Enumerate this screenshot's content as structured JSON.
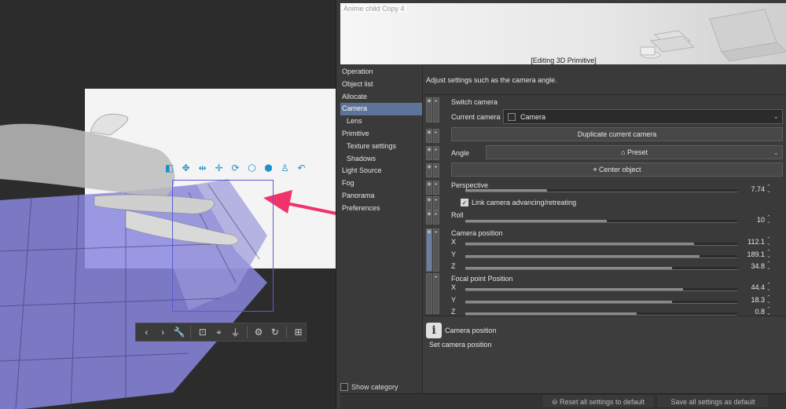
{
  "canvas": {
    "object_toolbar_icons": [
      "move-camera-icon",
      "pan-icon",
      "rotate-icon",
      "move-object-icon",
      "rotate-object-icon",
      "rotate-xy-icon",
      "scale-icon",
      "pose-icon",
      "undo-icon"
    ],
    "bottom_toolbar_icons": [
      "previous-icon",
      "next-icon",
      "wrench-icon",
      "camera-icon",
      "fit-icon",
      "ground-icon",
      "object-settings-icon",
      "rotate-reset-icon",
      "transform-icon"
    ],
    "accent_color": "#5b5bd0",
    "arrow_color": "#f0336b"
  },
  "panel": {
    "preview_title": "Anime child Copy 4",
    "preview_status": "[Editing 3D Primitive]",
    "categories": [
      {
        "label": "Operation",
        "sub": false,
        "active": false
      },
      {
        "label": "Object list",
        "sub": false,
        "active": false
      },
      {
        "label": "Allocate",
        "sub": false,
        "active": false
      },
      {
        "label": "Camera",
        "sub": false,
        "active": true
      },
      {
        "label": "Lens",
        "sub": true,
        "active": false
      },
      {
        "label": "Primitive",
        "sub": false,
        "active": false
      },
      {
        "label": "Texture settings",
        "sub": true,
        "active": false
      },
      {
        "label": "Shadows",
        "sub": true,
        "active": false
      },
      {
        "label": "Light Source",
        "sub": false,
        "active": false
      },
      {
        "label": "Fog",
        "sub": false,
        "active": false
      },
      {
        "label": "Panorama",
        "sub": false,
        "active": false
      },
      {
        "label": "Preferences",
        "sub": false,
        "active": false
      }
    ],
    "show_category": "Show category",
    "description": "Adjust settings such as the camera angle.",
    "switch_camera": "Switch camera",
    "current_camera_label": "Current camera",
    "current_camera_value": "Camera",
    "duplicate_button": "Duplicate current camera",
    "angle_label": "Angle",
    "angle_value": "Preset",
    "center_button": "Center object",
    "perspective_label": "Perspective",
    "perspective_value": "7.74",
    "perspective_level": 0.3,
    "link_label": "Link camera advancing/retreating",
    "link_checked": true,
    "roll_label": "Roll",
    "roll_value": "10",
    "roll_level": 0.52,
    "camera_position_label": "Camera position",
    "camera_position": [
      {
        "axis": "X",
        "value": "112.1",
        "level": 0.84
      },
      {
        "axis": "Y",
        "value": "189.1",
        "level": 0.86
      },
      {
        "axis": "Z",
        "value": "34.8",
        "level": 0.76
      }
    ],
    "focal_label": "Focal point Position",
    "focal_position": [
      {
        "axis": "X",
        "value": "44.4",
        "level": 0.8
      },
      {
        "axis": "Y",
        "value": "18.3",
        "level": 0.76
      },
      {
        "axis": "Z",
        "value": "0.8",
        "level": 0.63
      }
    ],
    "tip_title": "Camera position",
    "tip_text": "Set camera position",
    "reset_button": "Reset all settings to default",
    "save_button": "Save all settings as default"
  }
}
